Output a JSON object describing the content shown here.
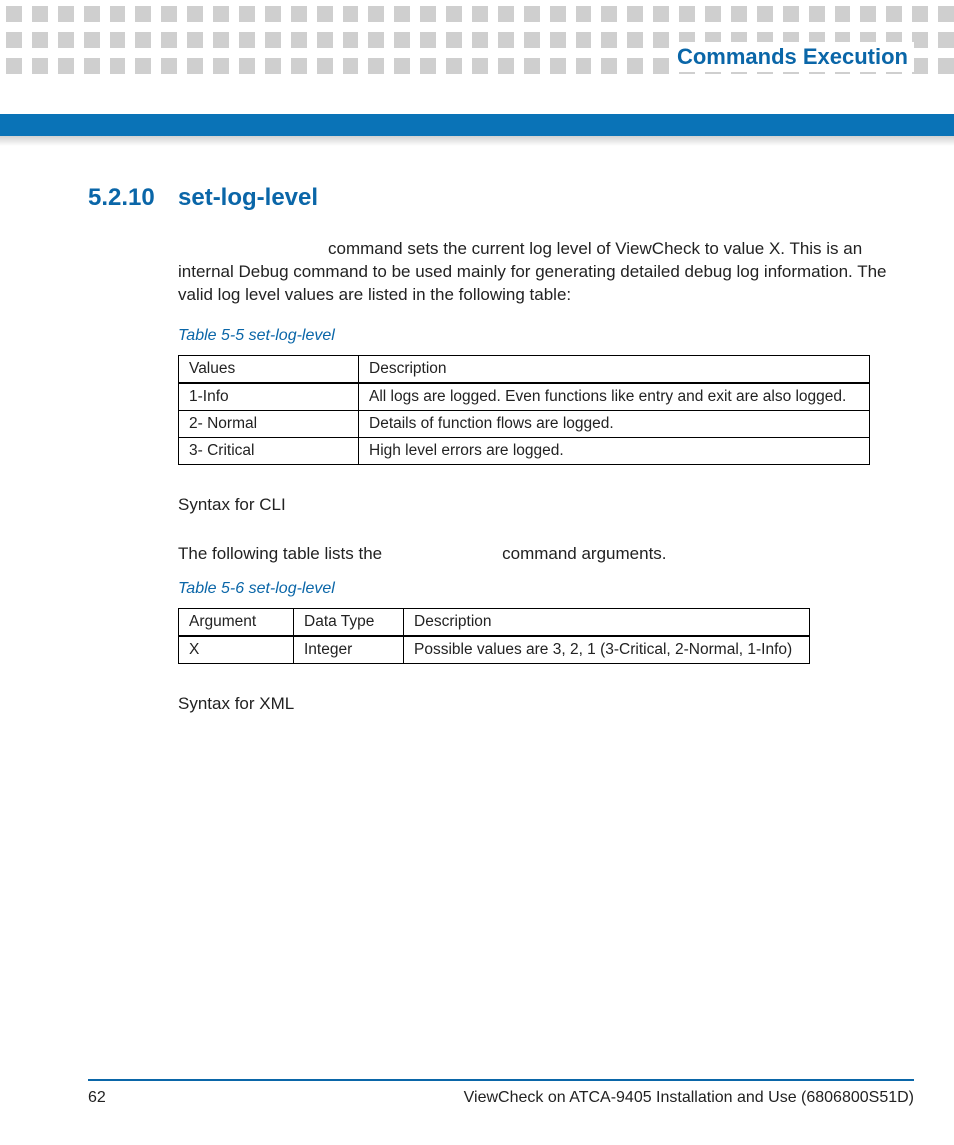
{
  "header": {
    "title": "Commands Execution"
  },
  "section": {
    "number": "5.2.10",
    "title": "set-log-level"
  },
  "intro": {
    "line1_suffix": "command sets the current log level of ViewCheck to value X. This is an",
    "line2": "internal Debug command to be used mainly for generating detailed debug log information.",
    "line3": "The valid log level values are listed in the following table:"
  },
  "table1": {
    "caption": "Table 5-5 set-log-level",
    "headers": [
      "Values",
      "Description"
    ],
    "rows": [
      [
        "1-Info",
        "All logs are logged. Even functions like entry and exit are also logged."
      ],
      [
        "2- Normal",
        "Details of function flows are logged."
      ],
      [
        "3- Critical",
        "High level errors are logged."
      ]
    ]
  },
  "syntax_cli": "Syntax for CLI",
  "mid_sentence": {
    "prefix": "The following table lists the",
    "suffix": "command arguments."
  },
  "table2": {
    "caption": "Table 5-6 set-log-level",
    "headers": [
      "Argument",
      "Data Type",
      "Description"
    ],
    "rows": [
      [
        "X",
        "Integer",
        "Possible values are 3, 2, 1 (3-Critical, 2-Normal, 1-Info)"
      ]
    ]
  },
  "syntax_xml": "Syntax for XML",
  "footer": {
    "page": "62",
    "doc": "ViewCheck on ATCA-9405 Installation and Use (6806800S51D)"
  }
}
